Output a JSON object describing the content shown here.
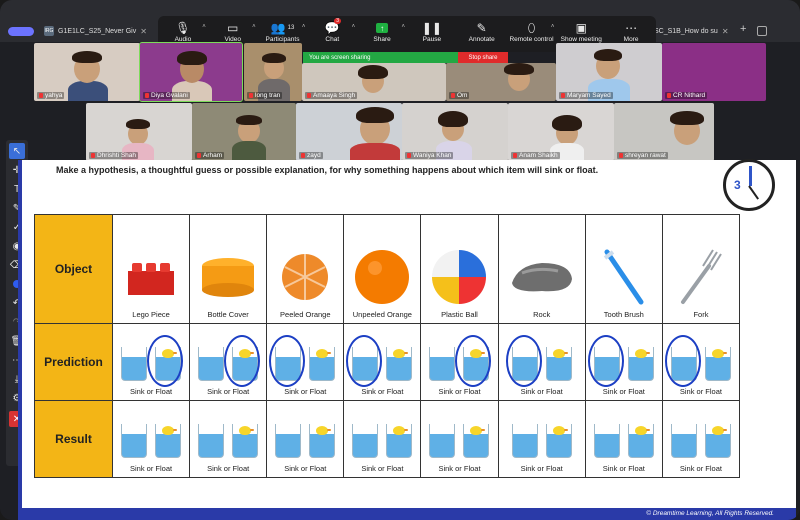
{
  "tabs": [
    {
      "label": "G1E1LC_S25_Never Giv",
      "favicon": "IRG"
    },
    {
      "label": "SC_S1B_How do su"
    }
  ],
  "toolbar": {
    "items": [
      {
        "label": "Audio",
        "icon": "microphone-icon"
      },
      {
        "label": "Video",
        "icon": "camera-icon"
      },
      {
        "label": "Participants",
        "icon": "people-icon",
        "count": "13"
      },
      {
        "label": "Chat",
        "icon": "chat-icon",
        "badge": "3"
      },
      {
        "label": "Share",
        "icon": "share-screen-icon"
      },
      {
        "label": "Pause",
        "icon": "pause-icon"
      },
      {
        "label": "Annotate",
        "icon": "pen-icon"
      },
      {
        "label": "Remote control",
        "icon": "mouse-icon"
      },
      {
        "label": "Show meeting",
        "icon": "meeting-window-icon"
      },
      {
        "label": "More",
        "icon": "more-icon"
      }
    ]
  },
  "banner": {
    "sharing": "You are screen sharing",
    "stop": "Stop share"
  },
  "participants": {
    "row1": [
      "yahya",
      "Diya Gvalani",
      "long tran",
      "Amaaya Singh",
      "Om",
      "Maryam Sayed",
      "CR Nithard"
    ],
    "row2": [
      "Dhrishti Shah",
      "Arham",
      "zayd",
      "Waniya Khan",
      "Anam Shaikh",
      "shreyan rawat"
    ]
  },
  "slide": {
    "instruction": "Make a hypothesis, a thoughtful guess or possible explanation, for why something happens about which item will sink or float.",
    "timer_number": "3",
    "row_labels": {
      "object": "Object",
      "prediction": "Prediction",
      "result": "Result"
    },
    "objects": [
      "Lego Piece",
      "Bottle Cover",
      "Peeled Orange",
      "Unpeeled Orange",
      "Plastic Ball",
      "Rock",
      "Tooth Brush",
      "Fork"
    ],
    "choice_text": "Sink or Float",
    "predictions_circled": [
      "float",
      "float",
      "sink",
      "sink",
      "float",
      "sink",
      "sink",
      "sink"
    ],
    "copyright": "© Dreamtime Learning, All Rights Reserved."
  },
  "colors": {
    "accent_yellow": "#f3b516",
    "annotation_blue": "#1c3fc4",
    "share_green": "#23a843",
    "stop_red": "#e02b2b"
  }
}
